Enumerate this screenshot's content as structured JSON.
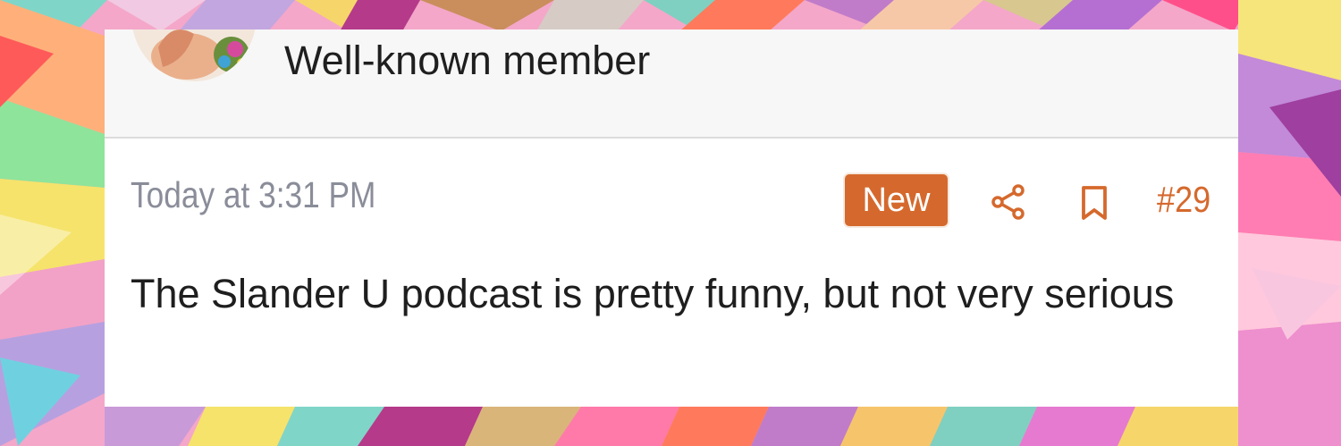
{
  "post": {
    "user_title": "Well-known member",
    "timestamp": "Today at 3:31 PM",
    "badge": "New",
    "post_number": "#29",
    "body_text": "The Slander U podcast is pretty funny, but not very serious"
  },
  "icons": {
    "share": "share-icon",
    "bookmark": "bookmark-icon"
  },
  "colors": {
    "accent": "#d5692d",
    "timestamp": "#8a8d99",
    "text": "#1e1e1e",
    "header_bg": "#f7f7f7",
    "divider": "#dcdcdc"
  }
}
